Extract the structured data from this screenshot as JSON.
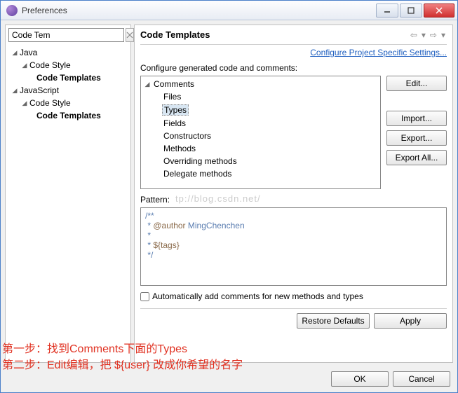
{
  "titlebar": {
    "title": "Preferences"
  },
  "filter": {
    "value": "Code Tem"
  },
  "leftTree": {
    "java": "Java",
    "codeStyle1": "Code Style",
    "codeTemplates1": "Code Templates",
    "js": "JavaScript",
    "codeStyle2": "Code Style",
    "codeTemplates2": "Code Templates"
  },
  "right": {
    "title": "Code Templates",
    "configLink": "Configure Project Specific Settings...",
    "cfgLabel": "Configure generated code and comments:",
    "tree": {
      "comments": "Comments",
      "files": "Files",
      "types": "Types",
      "fields": "Fields",
      "constructors": "Constructors",
      "methods": "Methods",
      "overriding": "Overriding methods",
      "delegate": "Delegate methods"
    },
    "buttons": {
      "edit": "Edit...",
      "import": "Import...",
      "export": "Export...",
      "exportAll": "Export All..."
    },
    "patternLabel": "Pattern:",
    "watermark": "tp://blog.csdn.net/",
    "pattern": {
      "l1": "/**",
      "l2": " * @author MingChenchen",
      "l3": " * ",
      "l4": " * ${tags}",
      "l5": " */"
    },
    "autoAdd": "Automatically add comments for new methods and types",
    "restore": "Restore Defaults",
    "apply": "Apply"
  },
  "footer": {
    "ok": "OK",
    "cancel": "Cancel"
  },
  "annot": {
    "step1": "第一步：找到Comments下面的Types",
    "step2": "第二步：Edit编辑，把 ${user} 改成你希望的名字"
  }
}
